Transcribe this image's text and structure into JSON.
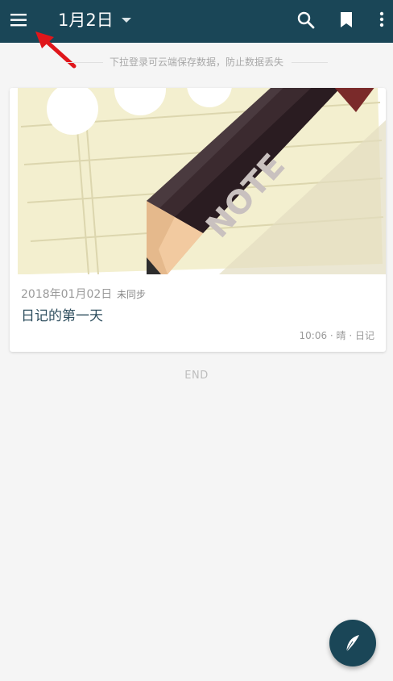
{
  "appbar": {
    "title": "1月2日",
    "icons": [
      "menu-icon",
      "caret-down-icon",
      "search-icon",
      "bookmark-icon",
      "more-vert-icon"
    ],
    "bg_color": "#1a4657"
  },
  "sync_hint": "下拉登录可云端保存数据，防止数据丢失",
  "notes": [
    {
      "date": "2018年01月02日",
      "sync_status": "未同步",
      "title": "日记的第一天",
      "meta": "10:06 · 晴 · 日记"
    }
  ],
  "list_end": "END",
  "fab": {
    "icon": "quill-icon"
  },
  "annotation": {
    "color": "#e0161b",
    "icon": "red-arrow"
  }
}
